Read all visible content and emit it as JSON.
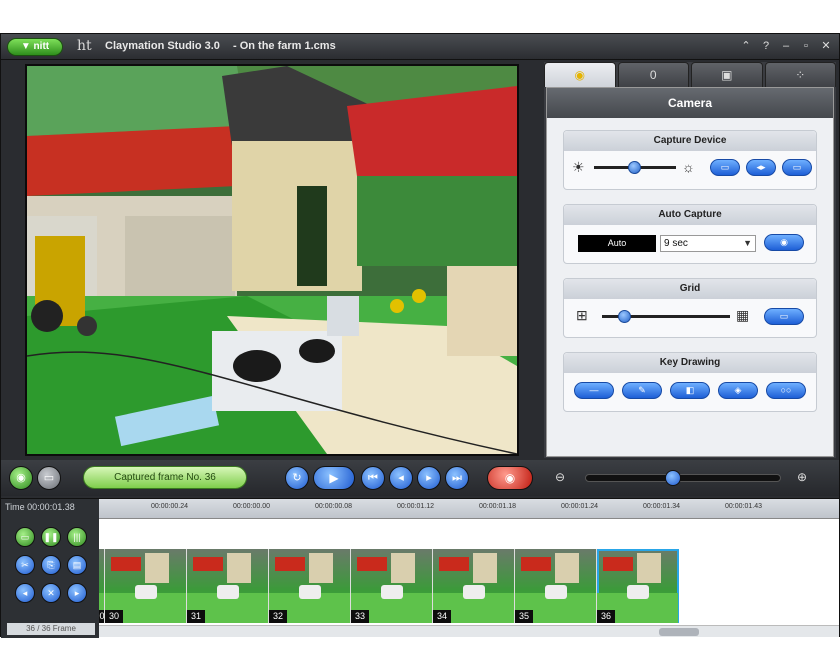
{
  "titlebar": {
    "menu_label": "▼ nitt",
    "logo_text": "ht",
    "app_title": "Claymation Studio 3.0",
    "project_name": "- On the farm 1.cms"
  },
  "panel": {
    "tabs": [
      "camera-icon",
      "0",
      "film-icon",
      "tools-icon"
    ],
    "header": "Camera",
    "capture_device": {
      "title": "Capture Device"
    },
    "auto_capture": {
      "title": "Auto Capture",
      "mode": "Auto",
      "interval": "9 sec"
    },
    "grid": {
      "title": "Grid"
    },
    "key_drawing": {
      "title": "Key Drawing"
    }
  },
  "transport": {
    "status": "Captured frame No. 36"
  },
  "timeline": {
    "time_label": "Time 00:00:01.38",
    "ruler_ticks": [
      "00:00:00.24",
      "00:00:00.00",
      "00:00:00.08",
      "00:00:01.12",
      "00:00:01.18",
      "00:00:01.24",
      "00:00:01.34",
      "00:00:01.43"
    ],
    "frames_label": "36 / 36 Frame",
    "frames": [
      "0",
      "30",
      "31",
      "32",
      "33",
      "34",
      "35",
      "36"
    ],
    "selected_frame": "36"
  },
  "colors": {
    "accent_blue": "#1f5bd0",
    "accent_green": "#7fce4c",
    "accent_red": "#c01b10",
    "tab_active_icon": "#e5b400"
  }
}
